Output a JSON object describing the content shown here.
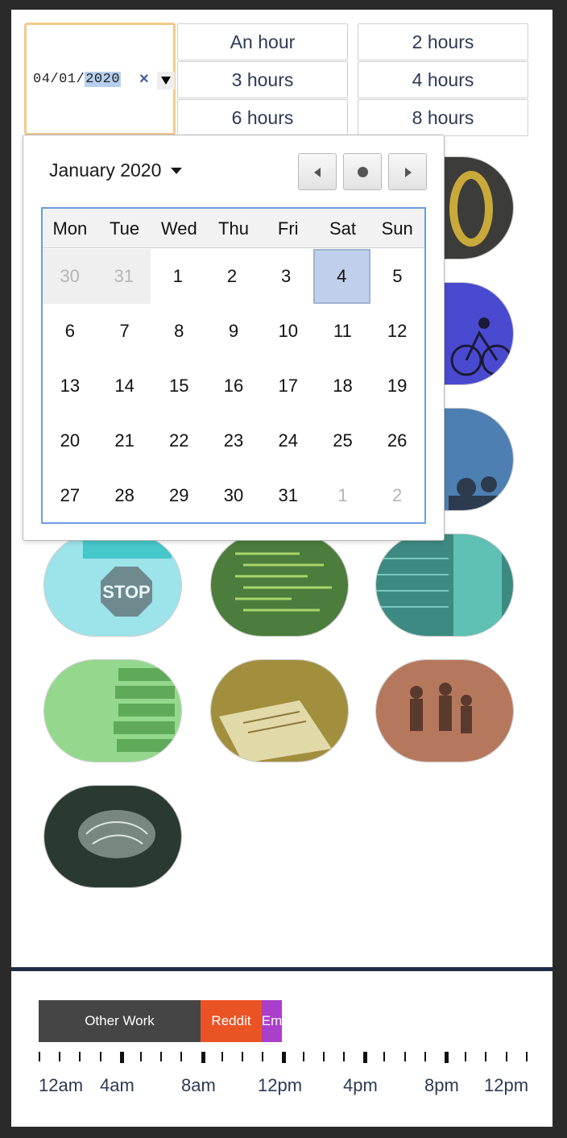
{
  "date_input": {
    "month": "04",
    "day": "01",
    "year": "2020",
    "sep": "/",
    "clear_symbol": "×"
  },
  "durations": [
    "An hour",
    "2 hours",
    "3 hours",
    "4 hours",
    "6 hours",
    "8 hours"
  ],
  "calendar": {
    "month_label": "January 2020",
    "weekdays": [
      "Mon",
      "Tue",
      "Wed",
      "Thu",
      "Fri",
      "Sat",
      "Sun"
    ],
    "weeks": [
      [
        "30",
        "31",
        "1",
        "2",
        "3",
        "4",
        "5"
      ],
      [
        "6",
        "7",
        "8",
        "9",
        "10",
        "11",
        "12"
      ],
      [
        "13",
        "14",
        "15",
        "16",
        "17",
        "18",
        "19"
      ],
      [
        "20",
        "21",
        "22",
        "23",
        "24",
        "25",
        "26"
      ],
      [
        "27",
        "28",
        "29",
        "30",
        "31",
        "1",
        "2"
      ]
    ],
    "selected_day": "4"
  },
  "tiles": [
    {
      "icon": "road-marking-icon",
      "color": "#5a5a4a"
    },
    {
      "icon": "cyclist-icon",
      "color": "#4848c8"
    },
    {
      "icon": "people-silhouette-icon",
      "color": "#3f6f9f"
    },
    {
      "icon": "stop-sign-icon",
      "color": "#8fdce4"
    },
    {
      "icon": "code-screen-icon",
      "color": "#4b7a3a"
    },
    {
      "icon": "neon-stairs-icon",
      "color": "#3f8a80"
    },
    {
      "icon": "book-stack-icon",
      "color": "#8fd48a"
    },
    {
      "icon": "tax-papers-icon",
      "color": "#9f8f3a"
    },
    {
      "icon": "family-photo-icon",
      "color": "#b0735a"
    },
    {
      "icon": "brain-icon",
      "color": "#2f3f35"
    }
  ],
  "timeline": {
    "segments": [
      {
        "label": "Other Work",
        "color": "#454545"
      },
      {
        "label": "Reddit",
        "color": "#ea5424"
      },
      {
        "label": "Em",
        "color": "#aa3fcb"
      }
    ],
    "labels": [
      "12am",
      "4am",
      "8am",
      "12pm",
      "4pm",
      "8pm",
      "12pm"
    ]
  }
}
